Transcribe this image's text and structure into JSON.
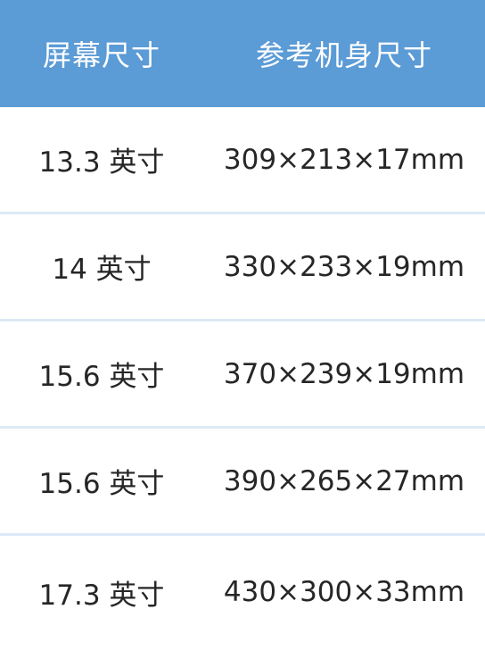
{
  "table": {
    "headers": [
      "屏幕尺寸",
      "参考机身尺寸"
    ],
    "rows": [
      [
        "13.3 英寸",
        "309×213×17mm"
      ],
      [
        "14 英寸",
        "330×233×19mm"
      ],
      [
        "15.6 英寸",
        "370×239×19mm"
      ],
      [
        "15.6 英寸",
        "390×265×27mm"
      ],
      [
        "17.3 英寸",
        "430×300×33mm"
      ]
    ],
    "header_bg": "#5b9bd6",
    "divider_color": "#dce9f6"
  }
}
